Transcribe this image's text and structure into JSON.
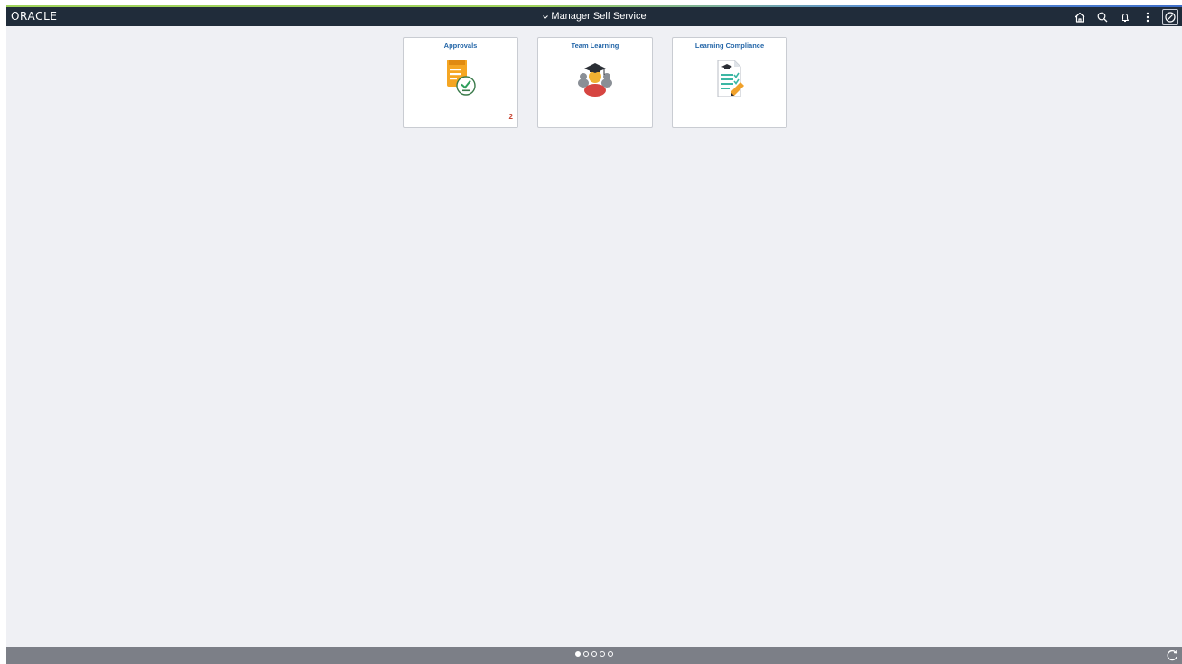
{
  "header": {
    "logo_text": "ORACLE",
    "title": "Manager Self Service",
    "actions": [
      {
        "name": "home-icon"
      },
      {
        "name": "search-icon"
      },
      {
        "name": "bell-icon"
      },
      {
        "name": "more-options-icon"
      },
      {
        "name": "navbar-compass-icon"
      }
    ]
  },
  "tiles": [
    {
      "title": "Approvals",
      "icon": "approvals-icon",
      "badge": "2"
    },
    {
      "title": "Team Learning",
      "icon": "team-learning-icon",
      "badge": ""
    },
    {
      "title": "Learning Compliance",
      "icon": "learning-compliance-icon",
      "badge": ""
    }
  ],
  "footer": {
    "page_count": 5,
    "active_page": 1,
    "refresh_icon": "refresh-icon"
  },
  "colors": {
    "header_bg": "#202c3a",
    "tile_title": "#2466a8",
    "badge": "#c74634",
    "page_bg": "#eff0f4",
    "footer_bg": "#7c7f87"
  }
}
